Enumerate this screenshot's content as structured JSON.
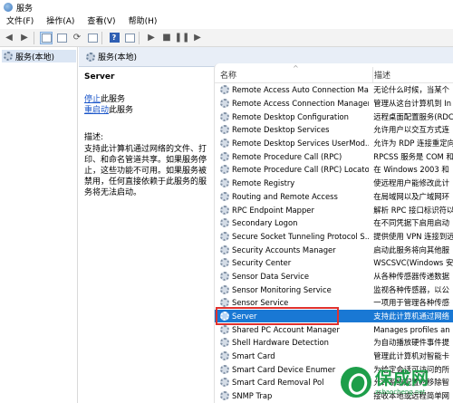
{
  "window": {
    "title": "服务"
  },
  "menu": [
    "文件(F)",
    "操作(A)",
    "查看(V)",
    "帮助(H)"
  ],
  "tree": {
    "root_label": "服务(本地)"
  },
  "header": {
    "title": "服务(本地)"
  },
  "detail": {
    "service_name": "Server",
    "stop_link": "停止",
    "stop_suffix": "此服务",
    "restart_link": "重启动",
    "restart_suffix": "此服务",
    "desc_label": "描述:",
    "desc_text": "支持此计算机通过网络的文件、打印、和命名管道共享。如果服务停止，这些功能不可用。如果服务被禁用，任何直接依赖于此服务的服务将无法启动。"
  },
  "list": {
    "columns": [
      "名称",
      "描述"
    ],
    "rows": [
      {
        "name": "Remote Access Auto Connection Ma...",
        "desc": "无论什么时候，当某个"
      },
      {
        "name": "Remote Access Connection Manager",
        "desc": "管理从这台计算机到 In"
      },
      {
        "name": "Remote Desktop Configuration",
        "desc": "远程桌面配置服务(RDC"
      },
      {
        "name": "Remote Desktop Services",
        "desc": "允许用户以交互方式连"
      },
      {
        "name": "Remote Desktop Services UserMod...",
        "desc": "允许为 RDP 连接重定向"
      },
      {
        "name": "Remote Procedure Call (RPC)",
        "desc": "RPCSS 服务是 COM 和"
      },
      {
        "name": "Remote Procedure Call (RPC) Locator",
        "desc": "在 Windows 2003 和"
      },
      {
        "name": "Remote Registry",
        "desc": "使远程用户能修改此计"
      },
      {
        "name": "Routing and Remote Access",
        "desc": "在局域网以及广域网环"
      },
      {
        "name": "RPC Endpoint Mapper",
        "desc": "解析 RPC 接口标识符以"
      },
      {
        "name": "Secondary Logon",
        "desc": "在不同凭据下启用启动"
      },
      {
        "name": "Secure Socket Tunneling Protocol S...",
        "desc": "提供使用 VPN 连接到远"
      },
      {
        "name": "Security Accounts Manager",
        "desc": "启动此服务将向其他服"
      },
      {
        "name": "Security Center",
        "desc": "WSCSVC(Windows 安"
      },
      {
        "name": "Sensor Data Service",
        "desc": "从各种传感器传递数据"
      },
      {
        "name": "Sensor Monitoring Service",
        "desc": "监视各种传感器，以公"
      },
      {
        "name": "Sensor Service",
        "desc": "一项用于管理各种传感"
      },
      {
        "name": "Server",
        "desc": "支持此计算机通过网络"
      },
      {
        "name": "Shared PC Account Manager",
        "desc": "Manages profiles an"
      },
      {
        "name": "Shell Hardware Detection",
        "desc": "为自动播放硬件事件提"
      },
      {
        "name": "Smart Card",
        "desc": "管理此计算机对智能卡"
      },
      {
        "name": "Smart Card Device Enumer",
        "desc": "为给定会话可访问的所"
      },
      {
        "name": "Smart Card Removal Pol",
        "desc": "允许系统配置为移除智"
      },
      {
        "name": "SNMP Trap",
        "desc": "接收本地或远程简单网"
      }
    ]
  },
  "watermark": {
    "text": "保成网",
    "url": "zsbaocheng.net"
  },
  "colors": {
    "selection": "#1978d4",
    "highlight": "#e0322e",
    "watermark": "#1d9e4a"
  }
}
